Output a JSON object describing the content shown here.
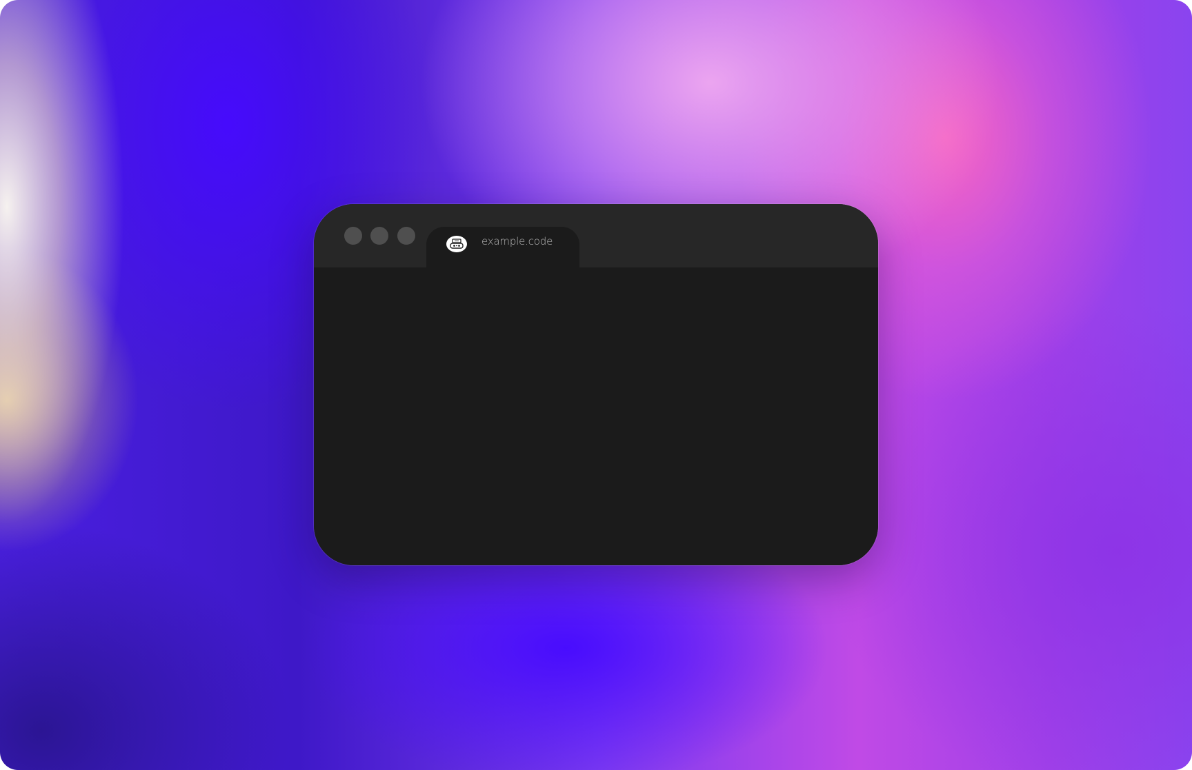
{
  "window": {
    "controls": [
      "close",
      "minimize",
      "maximize"
    ],
    "tab": {
      "title": "example.code",
      "favicon": "robot-face-icon"
    }
  },
  "colors": {
    "window_body": "#1b1b1b",
    "titlebar": "#272727",
    "traffic_light": "#4f4f4f",
    "tab_text": "#b9b9b9"
  }
}
